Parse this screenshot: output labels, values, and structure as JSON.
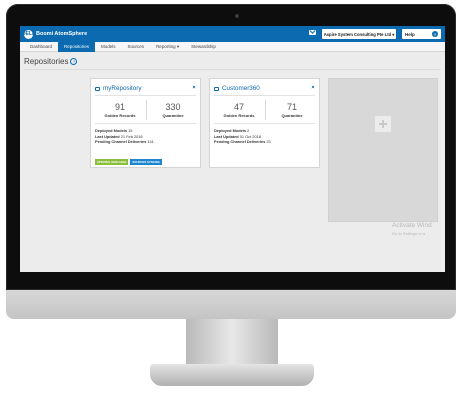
{
  "app": {
    "brand": "Boomi AtomSphere",
    "logo_text": "DELL"
  },
  "header": {
    "account_label": "Aspire System Consulting Pte Ltd",
    "help_label": "Help",
    "help_icon_text": "?"
  },
  "nav": {
    "items": [
      {
        "label": "Dashboard",
        "active": false
      },
      {
        "label": "Repositories",
        "active": true
      },
      {
        "label": "Models",
        "active": false
      },
      {
        "label": "Sources",
        "active": false
      },
      {
        "label": "Reporting ▾",
        "active": false
      },
      {
        "label": "Stewardship",
        "active": false
      }
    ]
  },
  "page": {
    "title": "Repositories",
    "info_icon_text": "?"
  },
  "repositories": [
    {
      "name": "myRepository",
      "golden_records": "91",
      "golden_label": "Golden Records",
      "quarantine": "330",
      "quarantine_label": "Quarantine",
      "deployed_models_label": "Deployed Models",
      "deployed_models": "15",
      "last_updated_label": "Last Updated",
      "last_updated": "21 Feb 2018",
      "pending_label": "Pending Channel Deliveries",
      "pending": "141",
      "badges": [
        "UPDATES AVAILABLE",
        "SOURCES SYNCING"
      ]
    },
    {
      "name": "Customer360",
      "golden_records": "47",
      "golden_label": "Golden Records",
      "quarantine": "71",
      "quarantine_label": "Quarantine",
      "deployed_models_label": "Deployed Models",
      "deployed_models": "2",
      "last_updated_label": "Last Updated",
      "last_updated": "01 Oct 2018",
      "pending_label": "Pending Channel Deliveries",
      "pending": "23",
      "badges": []
    }
  ],
  "watermark": {
    "line1": "Activate Wind",
    "line2": "Go to Settings to a"
  },
  "colors": {
    "primary": "#0b6ab0",
    "badge_green": "#8bbf3b",
    "badge_blue": "#1e86d1",
    "background": "#ececec"
  },
  "icons": [
    "dell-logo-icon",
    "mail-icon",
    "user-icon",
    "help-icon",
    "info-icon",
    "database-icon",
    "gear-icon",
    "add-icon"
  ]
}
